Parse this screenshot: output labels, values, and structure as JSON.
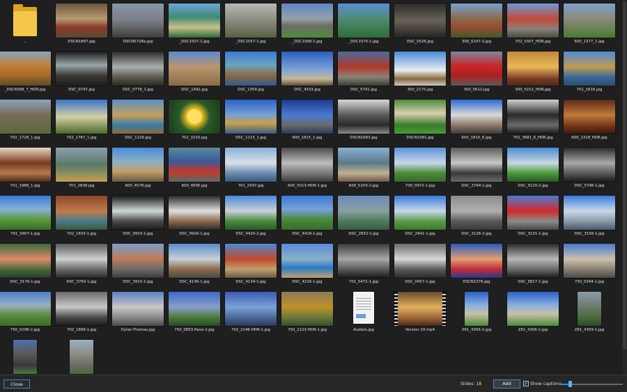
{
  "thumbnails": [
    {
      "caption": "..",
      "kind": "folder"
    },
    {
      "caption": "DSCN1897.jpg",
      "bg": "linear-gradient(180deg,#6b5640 0%,#b89a72 45%,#8a3a2a 70%,#5a4a38 100%)"
    },
    {
      "caption": "DSCN5728a.jpg",
      "bg": "linear-gradient(180deg,#8a96a8 0%,#7a7f86 50%,#3e3d3b 100%)"
    },
    {
      "caption": "_DSC1507-1.jpg",
      "bg": "linear-gradient(180deg,#6ea6d8 0%,#3f8a76 40%,#c9c08a 70%,#2e6a3a 100%)"
    },
    {
      "caption": "_DSC1557-1.jpg",
      "bg": "linear-gradient(180deg,#b6b8b6 0%,#8c8a7e 50%,#566046 100%)"
    },
    {
      "caption": "_DSC1568-1.jpg",
      "bg": "linear-gradient(180deg,#5e86c6 0%,#94a2a6 45%,#6e6c64 65%,#4f8a3e 100%)"
    },
    {
      "caption": "_DSC1575-1.jpg",
      "bg": "linear-gradient(180deg,#5a8ed2 0%,#4c8a6a 50%,#2f6b3b 100%)"
    },
    {
      "caption": "DSC_0526.jpg",
      "bg": "linear-gradient(180deg,#2c2c2c 0%,#6a6258 50%,#232323 100%)"
    },
    {
      "caption": "300_0147-3.jpg",
      "bg": "linear-gradient(180deg,#7aa0d0 0%,#8a6a4a 45%,#9a4a32 70%,#3e5a2a 100%)"
    },
    {
      "caption": "702_0307_HDR.jpg",
      "bg": "linear-gradient(180deg,#6c9ad6 0%,#c44a3a 45%,#8a8078 75%,#4a4846 100%)"
    },
    {
      "caption": "600_1377_1.jpg",
      "bg": "linear-gradient(180deg,#7aa2cc 0%,#8c8a78 45%,#4a7a34 100%)"
    },
    {
      "caption": "_DSC6068_7_HDR.jpg",
      "bg": "linear-gradient(180deg,#8aa2c0 0%,#c08038 40%,#a66a2a 70%,#5a4a2a 100%)"
    },
    {
      "caption": "DSC_0747.jpg",
      "bg": "linear-gradient(180deg,#1c1c1c 0%,#9aa6a8 40%,#3c3a36 70%,#1e1e1e 100%)"
    },
    {
      "caption": "DSC_0778_1.jpg",
      "bg": "linear-gradient(180deg,#2a2a28 0%,#aab0ae 45%,#5a5a50 75%,#2a2a26 100%)"
    },
    {
      "caption": "DSC_1492.jpg",
      "bg": "linear-gradient(180deg,#5a8ad0 0%,#b89670 45%,#8a6a44 100%)"
    },
    {
      "caption": "DSC_1359.jpg",
      "bg": "linear-gradient(180deg,#3e7ad0 0%,#6aa4c0 40%,#8a6a44 70%,#2e5a8a 100%)"
    },
    {
      "caption": "DSC_4533.jpg",
      "bg": "linear-gradient(180deg,#2a5ec0 0%,#7aa0d8 50%,#c4b89a 80%,#5a4a34 100%)"
    },
    {
      "caption": "DSC_5791.jpg",
      "bg": "linear-gradient(180deg,#4a6a9a 0%,#b03a2a 45%,#8a8276 75%,#3a3a38 100%)"
    },
    {
      "caption": "300_2175.jpg",
      "bg": "linear-gradient(180deg,#4a8ad8 0%,#e8ecf0 55%,#8a6a3e 80%,#c8c8c8 100%)"
    },
    {
      "caption": "300_5612.jpg",
      "bg": "linear-gradient(180deg,#7a8aa0 0%,#c8282a 40%,#b02020 70%,#5a5a5a 100%)"
    },
    {
      "caption": "300_0212_HDR.jpg",
      "bg": "linear-gradient(180deg,#c08a3a 0%,#e8b85a 45%,#7a3a22 80%,#4a2a1a 100%)"
    },
    {
      "caption": "701_1616.jpg",
      "bg": "linear-gradient(180deg,#4e8ad6 0%,#c09a50 45%,#3a6a9a 75%,#2e4a6a 100%)"
    },
    {
      "caption": "702_1728_1.jpg",
      "bg": "linear-gradient(180deg,#8aa4c0 0%,#7a6a58 45%,#5a6a3a 100%)"
    },
    {
      "caption": "702_1787_1.jpg",
      "bg": "linear-gradient(180deg,#3a72c8 0%,#d4cfa8 50%,#4a6a2a 100%)"
    },
    {
      "caption": "DSC_1129.jpg",
      "bg": "linear-gradient(180deg,#5a8ec8 0%,#c4a058 45%,#3a7aa6 75%,#8a6a3a 100%)"
    },
    {
      "caption": "702_1015.jpg",
      "bg": "radial-gradient(circle at 50% 50%,#ffe060 0 10px,#f0c020 11px,#2a5a2a 22px,#1a3a1a 100%)"
    },
    {
      "caption": "DSC_1115_1.jpg",
      "bg": "linear-gradient(180deg,#2a62c8 0%,#7aa0d8 45%,#c8a048 70%,#3a5a8a 100%)"
    },
    {
      "caption": "600_1815_1.jpg",
      "bg": "linear-gradient(180deg,#1a3a8a 0%,#4a7ad0 45%,#6a6a6a 75%,#2a3a5a 100%)"
    },
    {
      "caption": "DSCN1893.jpg",
      "bg": "linear-gradient(180deg,#d8d8d8 0%,#5a5a5a 45%,#2a2a2a 75%,#8a8a8a 100%)"
    },
    {
      "caption": "DSCN3381.jpg",
      "bg": "linear-gradient(180deg,#4a8a3a 0%,#d8d0b0 40%,#3a7a2a 75%,#4a9a3a 100%)"
    },
    {
      "caption": "600_1810_6.jpg",
      "bg": "linear-gradient(180deg,#2a6ad0 0%,#d8d8d8 45%,#8a7a6a 75%,#3a3a3a 100%)"
    },
    {
      "caption": "701_3681_6_HDR.jpg",
      "bg": "linear-gradient(180deg,#d0d0d0 0%,#2a2a2a 45%,#6a6a6a 75%,#1a1a1a 100%)"
    },
    {
      "caption": "600_1318_HDR.jpg",
      "bg": "linear-gradient(180deg,#5a2a1a 0%,#c07a3a 45%,#7a3a1a 75%,#3a1a0a 100%)"
    },
    {
      "caption": "701_1988_1.jpg",
      "bg": "linear-gradient(180deg,#e8d8c0 0%,#7a3a22 45%,#b07a4a 75%,#4a2a1a 100%)"
    },
    {
      "caption": "701_2838.jpg",
      "bg": "linear-gradient(180deg,#8aa0b0 0%,#5a7a6a 50%,#c0a050 100%)"
    },
    {
      "caption": "600_4578.jpg",
      "bg": "linear-gradient(180deg,#4a8ad8 0%,#8ab0c8 40%,#c0a068 70%,#6a5a40 100%)"
    },
    {
      "caption": "600_4695.jpg",
      "bg": "linear-gradient(180deg,#5a8a9a 0%,#3a5a9a 40%,#c03a2a 70%,#5a6a6a 100%)"
    },
    {
      "caption": "701_2597.jpg",
      "bg": "linear-gradient(180deg,#8ab0d8 0%,#d8e0e8 45%,#6a8ab0 75%,#3a5a7a 100%)"
    },
    {
      "caption": "600_5013-HDR-1.jpg",
      "bg": "linear-gradient(180deg,#4a4a4a 0%,#bcbcbc 45%,#7a7a7a 75%,#3a3a3a 100%)"
    },
    {
      "caption": "600_5203-2.jpg",
      "bg": "linear-gradient(180deg,#8ab0d0 0%,#5a7a8a 45%,#c0b090 75%,#6a5a4a 100%)"
    },
    {
      "caption": "700_0972-1.jpg",
      "bg": "linear-gradient(180deg,#5a90d8 0%,#c8d8e8 45%,#4a8a3a 75%,#3a6a2a 100%)"
    },
    {
      "caption": "DSC_3794-1.jpg",
      "bg": "linear-gradient(180deg,#5a5a5a 0%,#c8c8c8 45%,#3a3a3a 75%,#6a6a6a 100%)"
    },
    {
      "caption": "DSC_5120-2.jpg",
      "bg": "linear-gradient(180deg,#4a8ad0 0%,#c8d8e0 45%,#4a9a3a 75%,#2a5a2a 100%)"
    },
    {
      "caption": "DSC_5796-1.jpg",
      "bg": "linear-gradient(180deg,#2a2a2a 0%,#a8a8a8 45%,#5a5a5a 75%,#1a1a1a 100%)"
    },
    {
      "caption": "701_3907-1.jpg",
      "bg": "linear-gradient(180deg,#3a7ad0 0%,#8ab0d8 40%,#5a9a3a 70%,#3a6a2a 100%)"
    },
    {
      "caption": "702_1833-1.jpg",
      "bg": "linear-gradient(180deg,#8a4a2a 0%,#c07a4a 45%,#4a7a8a 75%,#3a5a3a 100%)"
    },
    {
      "caption": "DSC_0933-1.jpg",
      "bg": "linear-gradient(180deg,#1a1a1a 0%,#d0d8d8 45%,#4a4a4a 75%,#1a1a1a 100%)"
    },
    {
      "caption": "DSC_0926-1.jpg",
      "bg": "linear-gradient(180deg,#2a2a2a 0%,#e0e0e0 45%,#8a6a4a 75%,#2a2a2a 100%)"
    },
    {
      "caption": "DSC_4420-2.jpg",
      "bg": "linear-gradient(180deg,#4a8ad8 0%,#c8d0d8 45%,#4a8a3a 75%,#2a5a2a 100%)"
    },
    {
      "caption": "DSC_4418-1.jpg",
      "bg": "linear-gradient(180deg,#3a7ad0 0%,#7aa0d8 40%,#4a8a3a 70%,#3a6a2a 100%)"
    },
    {
      "caption": "DSC_2832-1.jpg",
      "bg": "linear-gradient(180deg,#6a8ac0 0%,#8aa0a0 45%,#4a7a5a 75%,#3a5a4a 100%)"
    },
    {
      "caption": "DSC_2941-1.jpg",
      "bg": "linear-gradient(180deg,#3a7ad8 0%,#c8d8e8 45%,#5a9a4a 75%,#3a7a2a 100%)"
    },
    {
      "caption": "DSC_3126-2.jpg",
      "bg": "linear-gradient(180deg,#8a8a8a 0%,#b0b0b0 45%,#5a5a5a 75%,#3a3a3a 100%)"
    },
    {
      "caption": "DSC_3131-1.jpg",
      "bg": "linear-gradient(180deg,#4a7ad0 0%,#d02a2a 45%,#8a8a8a 75%,#4a4a4a 100%)"
    },
    {
      "caption": "DSC_3156-1.jpg",
      "bg": "linear-gradient(180deg,#3a7ad8 0%,#c8d8e8 45%,#8a9aa8 75%,#4a5a6a 100%)"
    },
    {
      "caption": "DSC_3176-1.jpg",
      "bg": "linear-gradient(180deg,#3a6a3a 0%,#e08a6a 45%,#4a6a3a 75%,#2a3a2a 100%)"
    },
    {
      "caption": "DSC_3793-1.jpg",
      "bg": "linear-gradient(180deg,#5a5a5a 0%,#d0d0d0 45%,#6a6a6a 75%,#2a2a2a 100%)"
    },
    {
      "caption": "DSC_3915-1.jpg",
      "bg": "linear-gradient(180deg,#7aa0c8 0%,#c07a5a 45%,#6a6a6a 75%,#3a3a3a 100%)"
    },
    {
      "caption": "DSC_4136-1.jpg",
      "bg": "linear-gradient(180deg,#5a8ac8 0%,#c8d0d8 45%,#8a6a4a 75%,#4a4a4a 100%)"
    },
    {
      "caption": "DSC_4134-1.jpg",
      "bg": "linear-gradient(180deg,#4a8ad0 0%,#c04a2a 45%,#c0a070 75%,#6a5a40 100%)"
    },
    {
      "caption": "DSC_4216-1.jpg",
      "bg": "linear-gradient(180deg,#5a8ad8 0%,#8ab0c8 45%,#2a7ac8 70%,#c0a070 100%)"
    },
    {
      "caption": "701_5471-1.jpg",
      "bg": "linear-gradient(180deg,#3a3a3a 0%,#a8a8a8 45%,#5a5a5a 75%,#1a1a1a 100%)"
    },
    {
      "caption": "DSC_0457-1.jpg",
      "bg": "linear-gradient(180deg,#6a6a6a 0%,#d8d8d8 45%,#5a5a5a 75%,#2a2a2a 100%)"
    },
    {
      "caption": "DSCN1376.jpg",
      "bg": "linear-gradient(180deg,#2a5ac0 0%,#e0a070 45%,#c02a3a 75%,#2a3a8a 100%)"
    },
    {
      "caption": "DSC_5817-1.jpg",
      "bg": "linear-gradient(180deg,#2a2a2a 0%,#b8b8b8 45%,#6a6a6a 75%,#1a1a1a 100%)"
    },
    {
      "caption": "750_0294-1.jpg",
      "bg": "linear-gradient(180deg,#4a7ac8 0%,#c8c0b0 45%,#8a8070 75%,#4a4a4a 100%)"
    },
    {
      "caption": "750_0296-2.jpg",
      "bg": "linear-gradient(180deg,#4a80c8 0%,#9ab0c0 40%,#5a8a3a 70%,#3a6a2a 100%)"
    },
    {
      "caption": "702_1899-1.jpg",
      "bg": "linear-gradient(180deg,#6a6a6a 0%,#c8c8c8 45%,#4a4a4a 75%,#1a1a1a 100%)"
    },
    {
      "caption": "Dylan-Thomas.jpg",
      "bg": "linear-gradient(180deg,#5a80c0 0%,#c8c8c8 45%,#8a8a8a 75%,#4a4a4a 100%)"
    },
    {
      "caption": "750_0853-Pano-2.jpg",
      "bg": "linear-gradient(180deg,#3a6ac8 0%,#8aa0c8 45%,#4a7a3a 75%,#2a4a2a 100%)"
    },
    {
      "caption": "702_2146-HDR-1.jpg",
      "bg": "linear-gradient(180deg,#3a5ab0 0%,#7aa0d8 45%,#4a6a9a 75%,#2a3a5a 100%)"
    },
    {
      "caption": "750_2223-HDR-1.jpg",
      "bg": "linear-gradient(180deg,#8a7a5a 0%,#c0902a 45%,#6a7a3a 75%,#3a4a2a 100%)"
    },
    {
      "caption": "Audials.jpg",
      "kind": "doc",
      "bg": "#f2f2f2"
    },
    {
      "caption": "Version 10.mp4",
      "kind": "video",
      "bg": "linear-gradient(180deg,#6a4a2a 0%,#e0b060 45%,#a06a3a 75%,#4a2a1a 100%)"
    },
    {
      "caption": "Z61_4356-2.jpg",
      "kind": "portrait",
      "bg": "linear-gradient(180deg,#2a60c8 0%,#8ab0e0 40%,#c8c0a8 65%,#4a8a3a 100%)"
    },
    {
      "caption": "Z61_4356-1.jpg",
      "bg": "linear-gradient(180deg,#2a60c8 0%,#8ab0e0 40%,#c8c0a8 65%,#4a8a3a 100%)"
    },
    {
      "caption": "Z61_4359-1.jpg",
      "kind": "portrait",
      "bg": "linear-gradient(180deg,#8a9aa8 0%,#6a7a6a 45%,#4a6a3a 75%,#2a4a2a 100%)"
    },
    {
      "caption": "",
      "kind": "portrait",
      "bg": "linear-gradient(180deg,#4a70b0 0%,#5a5a5a 40%,#3a3a3a 75%,#4a7a3a 100%)"
    },
    {
      "caption": "",
      "kind": "portrait",
      "bg": "linear-gradient(180deg,#9ab0c0 0%,#8a8a80 45%,#6a6a60 75%,#4a6a3a 100%)"
    }
  ],
  "bottom": {
    "close_label": "Close",
    "slides_text": "Slides: 18",
    "add_label": "Add",
    "show_captions_label": "Show captions",
    "show_captions_checked": true,
    "zoom_fraction": 0.16,
    "accent_color": "#2d8fd6"
  }
}
